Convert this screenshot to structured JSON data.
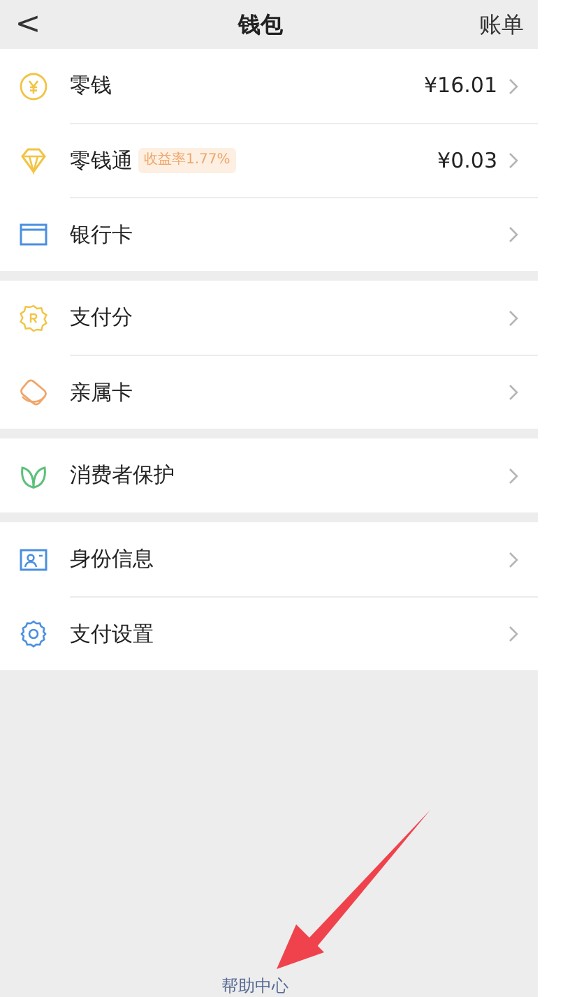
{
  "header": {
    "back": "<",
    "title": "钱包",
    "action": "账单"
  },
  "groups": [
    {
      "rows": [
        {
          "label": "零钱",
          "value": "¥16.01"
        },
        {
          "label": "零钱通",
          "badge": "收益率1.77%",
          "value": "¥0.03"
        },
        {
          "label": "银行卡"
        }
      ]
    },
    {
      "rows": [
        {
          "label": "支付分"
        },
        {
          "label": "亲属卡"
        }
      ]
    },
    {
      "rows": [
        {
          "label": "消费者保护"
        }
      ]
    },
    {
      "rows": [
        {
          "label": "身份信息"
        },
        {
          "label": "支付设置"
        }
      ]
    }
  ],
  "footer_link": "帮助中心"
}
